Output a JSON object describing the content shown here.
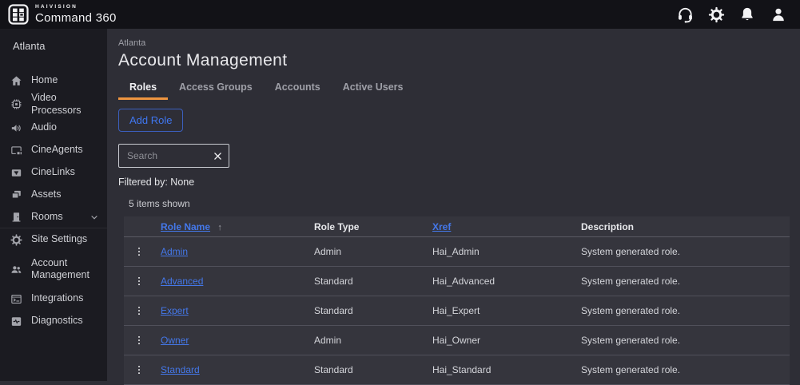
{
  "colors": {
    "accent_orange": "#ee9540",
    "button_blue": "#3f76f0",
    "link_blue": "#4478ea"
  },
  "topbar": {
    "brand_small": "HAIVISION",
    "brand_name": "Command 360",
    "icons": [
      "support",
      "settings",
      "notifications",
      "account"
    ]
  },
  "sidebar": {
    "site": "Atlanta",
    "items": [
      {
        "label": "Home"
      },
      {
        "label": "Video Processors"
      },
      {
        "label": "Audio"
      },
      {
        "label": "CineAgents"
      },
      {
        "label": "CineLinks"
      },
      {
        "label": "Assets"
      },
      {
        "label": "Rooms"
      },
      {
        "label": "Site Settings"
      },
      {
        "label": "Account Management"
      },
      {
        "label": "Integrations"
      },
      {
        "label": "Diagnostics"
      }
    ]
  },
  "main": {
    "breadcrumb": "Atlanta",
    "title": "Account Management",
    "tabs": [
      {
        "label": "Roles",
        "active": true
      },
      {
        "label": "Access Groups",
        "active": false
      },
      {
        "label": "Accounts",
        "active": false
      },
      {
        "label": "Active Users",
        "active": false
      }
    ],
    "add_role_label": "Add Role",
    "search_placeholder": "Search",
    "filtered_by": "Filtered by: None",
    "items_shown": "5 items shown",
    "table": {
      "sort_indicator": "↑",
      "columns": [
        {
          "label": "Role Name"
        },
        {
          "label": "Role Type"
        },
        {
          "label": "Xref"
        },
        {
          "label": "Description"
        }
      ],
      "rows": [
        {
          "role_name": "Admin",
          "role_type": "Admin",
          "xref": "Hai_Admin",
          "description": "System generated role."
        },
        {
          "role_name": "Advanced",
          "role_type": "Standard",
          "xref": "Hai_Advanced",
          "description": "System generated role."
        },
        {
          "role_name": "Expert",
          "role_type": "Standard",
          "xref": "Hai_Expert",
          "description": "System generated role."
        },
        {
          "role_name": "Owner",
          "role_type": "Admin",
          "xref": "Hai_Owner",
          "description": "System generated role."
        },
        {
          "role_name": "Standard",
          "role_type": "Standard",
          "xref": "Hai_Standard",
          "description": "System generated role."
        }
      ]
    }
  }
}
